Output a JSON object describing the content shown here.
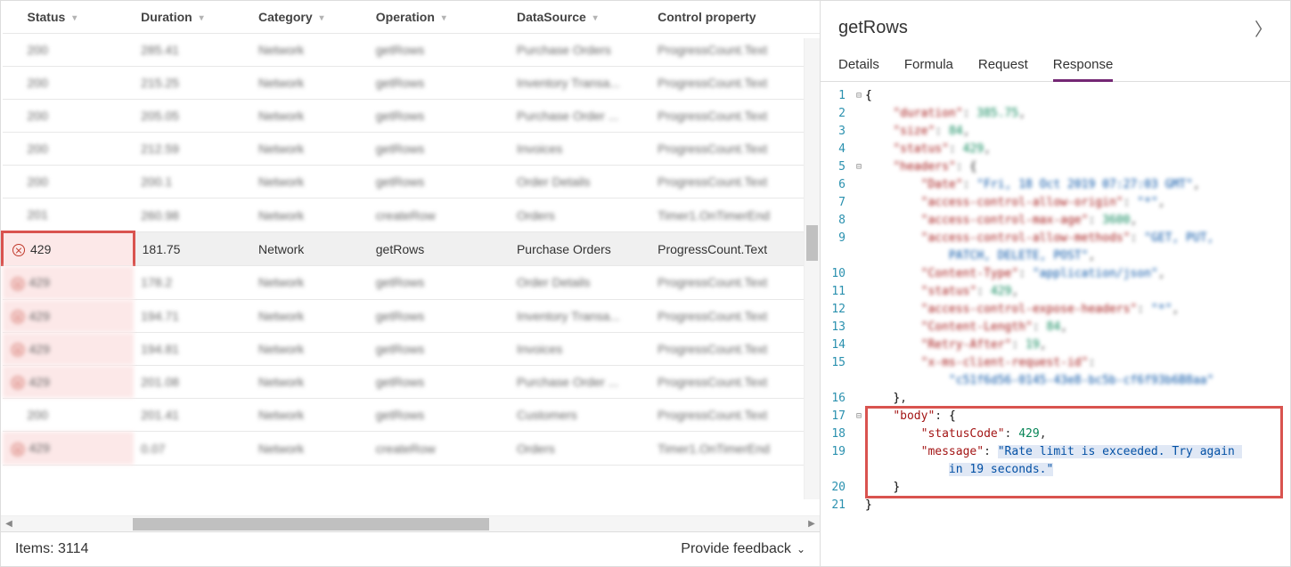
{
  "columns": {
    "status": "Status",
    "duration": "Duration",
    "category": "Category",
    "operation": "Operation",
    "datasource": "DataSource",
    "control": "Control property"
  },
  "rows": [
    {
      "status": "200",
      "duration": "285.41",
      "category": "Network",
      "operation": "getRows",
      "datasource": "Purchase Orders",
      "control": "ProgressCount.Text",
      "error": false,
      "blur": true
    },
    {
      "status": "200",
      "duration": "215.25",
      "category": "Network",
      "operation": "getRows",
      "datasource": "Inventory Transa...",
      "control": "ProgressCount.Text",
      "error": false,
      "blur": true
    },
    {
      "status": "200",
      "duration": "205.05",
      "category": "Network",
      "operation": "getRows",
      "datasource": "Purchase Order ...",
      "control": "ProgressCount.Text",
      "error": false,
      "blur": true
    },
    {
      "status": "200",
      "duration": "212.59",
      "category": "Network",
      "operation": "getRows",
      "datasource": "Invoices",
      "control": "ProgressCount.Text",
      "error": false,
      "blur": true
    },
    {
      "status": "200",
      "duration": "200.1",
      "category": "Network",
      "operation": "getRows",
      "datasource": "Order Details",
      "control": "ProgressCount.Text",
      "error": false,
      "blur": true
    },
    {
      "status": "201",
      "duration": "260.98",
      "category": "Network",
      "operation": "createRow",
      "datasource": "Orders",
      "control": "Timer1.OnTimerEnd",
      "error": false,
      "blur": true
    },
    {
      "status": "429",
      "duration": "181.75",
      "category": "Network",
      "operation": "getRows",
      "datasource": "Purchase Orders",
      "control": "ProgressCount.Text",
      "error": true,
      "blur": false,
      "selected": true,
      "highlight": true
    },
    {
      "status": "429",
      "duration": "178.2",
      "category": "Network",
      "operation": "getRows",
      "datasource": "Order Details",
      "control": "ProgressCount.Text",
      "error": true,
      "blur": true
    },
    {
      "status": "429",
      "duration": "194.71",
      "category": "Network",
      "operation": "getRows",
      "datasource": "Inventory Transa...",
      "control": "ProgressCount.Text",
      "error": true,
      "blur": true
    },
    {
      "status": "429",
      "duration": "194.81",
      "category": "Network",
      "operation": "getRows",
      "datasource": "Invoices",
      "control": "ProgressCount.Text",
      "error": true,
      "blur": true
    },
    {
      "status": "429",
      "duration": "201.08",
      "category": "Network",
      "operation": "getRows",
      "datasource": "Purchase Order ...",
      "control": "ProgressCount.Text",
      "error": true,
      "blur": true
    },
    {
      "status": "200",
      "duration": "201.41",
      "category": "Network",
      "operation": "getRows",
      "datasource": "Customers",
      "control": "ProgressCount.Text",
      "error": false,
      "blur": true
    },
    {
      "status": "429",
      "duration": "0.07",
      "category": "Network",
      "operation": "createRow",
      "datasource": "Orders",
      "control": "Timer1.OnTimerEnd",
      "error": true,
      "blur": true
    }
  ],
  "footer": {
    "items_label": "Items: 3114",
    "feedback": "Provide feedback"
  },
  "detail": {
    "title": "getRows",
    "tabs": {
      "details": "Details",
      "formula": "Formula",
      "request": "Request",
      "response": "Response"
    },
    "response_json": {
      "duration": 385.75,
      "size": 84,
      "status": 429,
      "headers": {
        "Date": "Fri, 18 Oct 2019 07:27:03 GMT",
        "access-control-allow-origin": "*",
        "access-control-max-age": 3600,
        "access-control-allow-methods": "GET, PUT, PATCH, DELETE, POST",
        "Content-Type": "application/json",
        "status": 429,
        "access-control-expose-headers": "*",
        "Content-Length": 84,
        "Retry-After": 19,
        "x-ms-client-request-id": "c51f6d56-0145-43e8-bc5b-cf6f93b6B8aa"
      },
      "body": {
        "statusCode": 429,
        "message": "Rate limit is exceeded. Try again in 19 seconds."
      }
    },
    "lines": [
      {
        "n": 1,
        "fold": "⊟",
        "html": "<span class='tok-brace'>{</span>",
        "blur": false
      },
      {
        "n": 2,
        "fold": "",
        "html": "    <span class='tok-key'>\"duration\"</span>: <span class='tok-num'>385.75</span>,",
        "blur": true
      },
      {
        "n": 3,
        "fold": "",
        "html": "    <span class='tok-key'>\"size\"</span>: <span class='tok-num'>84</span>,",
        "blur": true
      },
      {
        "n": 4,
        "fold": "",
        "html": "    <span class='tok-key'>\"status\"</span>: <span class='tok-num'>429</span>,",
        "blur": true
      },
      {
        "n": 5,
        "fold": "⊟",
        "html": "    <span class='tok-key'>\"headers\"</span>: <span class='tok-brace'>{</span>",
        "blur": true
      },
      {
        "n": 6,
        "fold": "",
        "html": "        <span class='tok-key'>\"Date\"</span>: <span class='tok-str'>\"Fri, 18 Oct 2019 07:27:03 GMT\"</span>,",
        "blur": true
      },
      {
        "n": 7,
        "fold": "",
        "html": "        <span class='tok-key'>\"access-control-allow-origin\"</span>: <span class='tok-str'>\"*\"</span>,",
        "blur": true
      },
      {
        "n": 8,
        "fold": "",
        "html": "        <span class='tok-key'>\"access-control-max-age\"</span>: <span class='tok-num'>3600</span>,",
        "blur": true
      },
      {
        "n": 9,
        "fold": "",
        "html": "        <span class='tok-key'>\"access-control-allow-methods\"</span>: <span class='tok-str'>\"GET, PUT,<br>            PATCH, DELETE, POST\"</span>,",
        "blur": true
      },
      {
        "n": 10,
        "fold": "",
        "html": "        <span class='tok-key'>\"Content-Type\"</span>: <span class='tok-str'>\"application/json\"</span>,",
        "blur": true
      },
      {
        "n": 11,
        "fold": "",
        "html": "        <span class='tok-key'>\"status\"</span>: <span class='tok-num'>429</span>,",
        "blur": true
      },
      {
        "n": 12,
        "fold": "",
        "html": "        <span class='tok-key'>\"access-control-expose-headers\"</span>: <span class='tok-str'>\"*\"</span>,",
        "blur": true
      },
      {
        "n": 13,
        "fold": "",
        "html": "        <span class='tok-key'>\"Content-Length\"</span>: <span class='tok-num'>84</span>,",
        "blur": true
      },
      {
        "n": 14,
        "fold": "",
        "html": "        <span class='tok-key'>\"Retry-After\"</span>: <span class='tok-num'>19</span>,",
        "blur": true
      },
      {
        "n": 15,
        "fold": "",
        "html": "        <span class='tok-key'>\"x-ms-client-request-id\"</span>:<br>            <span class='tok-str'>\"c51f6d56-0145-43e8-bc5b-cf6f93b6B8aa\"</span>",
        "blur": true
      },
      {
        "n": 16,
        "fold": "",
        "html": "    <span class='tok-brace'>}</span>,",
        "blur": false
      },
      {
        "n": 17,
        "fold": "⊟",
        "html": "    <span class='tok-key'>\"body\"</span>: <span class='tok-brace'>{</span>",
        "blur": false
      },
      {
        "n": 18,
        "fold": "",
        "html": "        <span class='tok-key'>\"statusCode\"</span>: <span class='tok-num'>429</span>,",
        "blur": false
      },
      {
        "n": 19,
        "fold": "",
        "html": "        <span class='tok-key'>\"message\"</span>: <span class='tok-str msg-highlight'>\"Rate limit is exceeded. Try again </span><br>            <span class='tok-str msg-highlight'>in 19 seconds.\"</span>",
        "blur": false
      },
      {
        "n": 20,
        "fold": "",
        "html": "    <span class='tok-brace'>}</span>",
        "blur": false
      },
      {
        "n": 21,
        "fold": "",
        "html": "<span class='tok-brace'>}</span>",
        "blur": false
      }
    ]
  }
}
